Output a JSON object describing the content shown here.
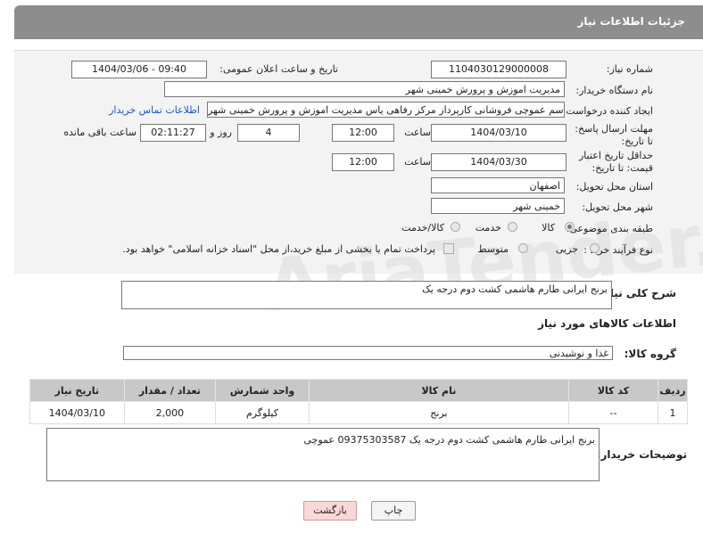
{
  "header": {
    "title": "جزئیات اطلاعات نیاز"
  },
  "labels": {
    "need_number": "شماره نیاز:",
    "announce_datetime": "تاریخ و ساعت اعلان عمومی:",
    "buyer_org": "نام دستگاه خریدار:",
    "requester": "ایجاد کننده درخواست:",
    "reply_deadline": "مهلت ارسال پاسخ: تا تاریخ:",
    "price_deadline": "حداقل تاریخ اعتبار قیمت: تا تاریخ:",
    "hour": "ساعت",
    "day_and": "روز و",
    "remaining": "ساعت باقی مانده",
    "province": "استان محل تحویل:",
    "city": "شهر محل تحویل:",
    "category": "طبقه بندی موضوعی:",
    "process": "نوع فرآیند خرید :",
    "general_desc": "شرح کلی نیاز:",
    "goods_info": "اطلاعات کالاهای مورد نیاز",
    "goods_group": "گروه کالا:",
    "buyer_notes": "توضیحات خریدار:"
  },
  "values": {
    "need_number": "1104030129000008",
    "announce_datetime": "1404/03/06 - 09:40",
    "buyer_org": "مدیریت اموزش و پرورش خمینی شهر",
    "requester": "ابوالقاسم عموچی فروشانی کارپرداز مرکز رفاهی یاس مدیریت اموزش و پرورش خمینی شهر",
    "contact_link": "اطلاعات تماس خریدار",
    "reply_date": "1404/03/10",
    "reply_time": "12:00",
    "days": "4",
    "remaining_time": "02:11:27",
    "price_date": "1404/03/30",
    "price_time": "12:00",
    "province": "اصفهان",
    "city": "خمینی شهر",
    "general_desc": "برنج ایرانی طارم هاشمی کشت دوم درجه یک",
    "goods_group": "غذا و نوشیدنی",
    "buyer_notes": "برنج ایرانی طارم هاشمی کشت دوم درجه یک     09375303587   عموچی"
  },
  "category_options": {
    "goods": "کالا",
    "service": "خدمت",
    "goods_service": "کالا/خدمت"
  },
  "process_options": {
    "minor": "جزیی",
    "medium": "متوسط"
  },
  "payment_note": "پرداخت تمام یا بخشی از مبلغ خرید،از محل \"اسناد خزانه اسلامی\" خواهد بود.",
  "table": {
    "headers": [
      "ردیف",
      "کد کالا",
      "نام کالا",
      "واحد شمارش",
      "تعداد / مقدار",
      "تاریخ نیاز"
    ],
    "rows": [
      [
        "1",
        "--",
        "برنج",
        "کیلوگرم",
        "2,000",
        "1404/03/10"
      ]
    ]
  },
  "buttons": {
    "print": "چاپ",
    "back": "بازگشت"
  },
  "watermark": "AriaTender.neT"
}
